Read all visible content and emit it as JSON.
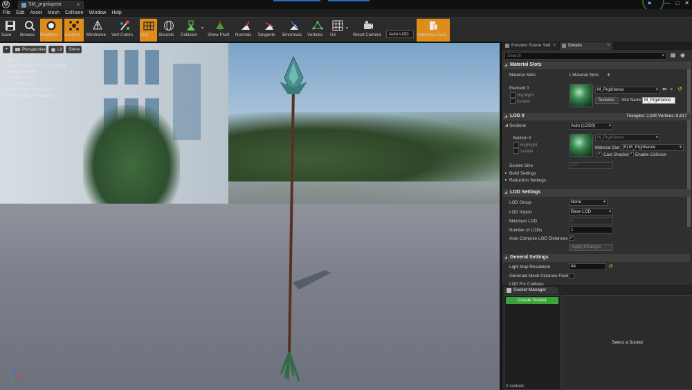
{
  "window": {
    "logo_text": "U",
    "tab_title": "SM_prgirlapear",
    "controls": [
      "—",
      "□",
      "✕"
    ]
  },
  "menu": [
    "File",
    "Edit",
    "Asset",
    "Mesh",
    "Collision",
    "Window",
    "Help"
  ],
  "toolbar": {
    "buttons": [
      {
        "label": "Save",
        "icon": "save-icon"
      },
      {
        "label": "Browse",
        "icon": "browse-icon"
      },
      {
        "label": "Realtime",
        "icon": "realtime-icon",
        "active": true
      },
      {
        "label": "Sockets",
        "icon": "sockets-icon",
        "active": true
      },
      {
        "label": "Wireframe",
        "icon": "wireframe-icon"
      },
      {
        "label": "Vert Colors",
        "icon": "vert-colors-icon"
      },
      {
        "label": "Grid",
        "icon": "grid-icon",
        "active": true
      },
      {
        "label": "Bounds",
        "icon": "bounds-icon"
      },
      {
        "label": "Collision",
        "icon": "collision-icon"
      },
      {
        "label": "Show Pivot",
        "icon": "pivot-icon"
      },
      {
        "label": "Normals",
        "icon": "normals-icon"
      },
      {
        "label": "Tangents",
        "icon": "tangents-icon"
      },
      {
        "label": "Binormals",
        "icon": "binormals-icon"
      },
      {
        "label": "Vertices",
        "icon": "vertices-icon"
      },
      {
        "label": "UV",
        "icon": "uv-icon"
      },
      {
        "label": "Reset Camera",
        "icon": "reset-camera-icon"
      },
      {
        "label": "Additional Data",
        "icon": "additional-data-icon",
        "active": true
      }
    ],
    "lod_select": "Auto LOD"
  },
  "viewport": {
    "menu_glyph": "▾",
    "perspective_label": "Perspective",
    "lit_label": "Lit",
    "show_label": "Show",
    "stats": [
      "LOD:  0",
      "Current Screen Size:  0.941082",
      "Triangles:  2,940",
      "Vertices:  8,817",
      "UV Channels:  2",
      "Approx Size: 13x11x182",
      "Num Collision Primitives:  1"
    ]
  },
  "right_panel": {
    "tabs": [
      "Preview Scene Sett",
      "Details"
    ],
    "search_placeholder": "Search",
    "material_slots": {
      "header": "Material Slots",
      "label": "Material Slots",
      "count": "1 Material Slots",
      "add_glyph": "+",
      "element_label": "Element 0",
      "highlight": "Highlight",
      "isolate": "Isolate",
      "material_name": "M_Prgirllance",
      "textures_label": "Textures",
      "slot_name_label": "Slot Name",
      "slot_name_value": "M_Prgirllance"
    },
    "lod0": {
      "header": "LOD 0",
      "triangles": "Triangles: 2,940",
      "vertices": "Vertices: 8,817",
      "sections_label": "Sections",
      "sections_value": "Auto (LOD0)",
      "section0_label": "Section 0",
      "highlight": "Highlight",
      "isolate": "Isolate",
      "section_material": "M_Prgirllance",
      "material_slot_label": "Material Slot",
      "material_slot_value": "[0] M_Prgirllance",
      "cast_shadow": "Cast Shadow",
      "enable_collision": "Enable Collision",
      "screen_size_label": "Screen Size",
      "screen_size_value": "1.0",
      "build_settings": "Build Settings",
      "reduction_settings": "Reduction Settings"
    },
    "lod_settings": {
      "header": "LOD Settings",
      "lod_group_label": "LOD Group",
      "lod_group_value": "None",
      "lod_import_label": "LOD Import",
      "lod_import_value": "Base LOD",
      "min_lod_label": "Minimum LOD",
      "min_lod_value": "0",
      "num_lods_label": "Number of LODs",
      "num_lods_value": "1",
      "auto_compute_label": "Auto Compute LOD Distances",
      "apply_changes": "Apply Changes"
    },
    "general_settings": {
      "header": "General Settings",
      "lightmap_label": "Light Map Resolution",
      "lightmap_value": "64",
      "gen_distance_field_label": "Generate Mesh Distance Field",
      "lod_for_collision_label": "LOD For Collision"
    }
  },
  "socket_manager": {
    "tab_label": "Socket Manager",
    "create_button": "Create Socket",
    "count_text": "0 sockets",
    "detail_text": "Select a Socket"
  },
  "colors": {
    "accent_orange": "#e08c1a",
    "create_green": "#3aa43a",
    "panel_bg": "#2f2f2f"
  }
}
